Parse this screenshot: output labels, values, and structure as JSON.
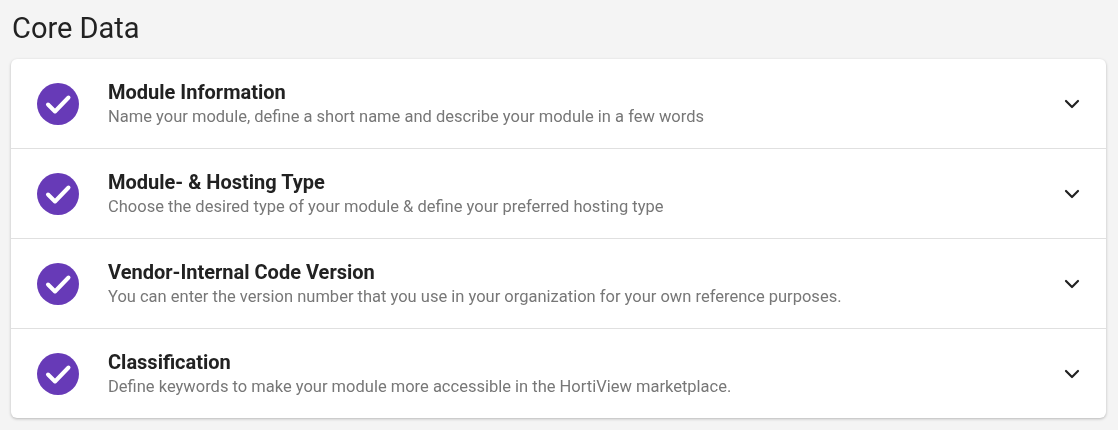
{
  "page": {
    "title": "Core Data"
  },
  "sections": [
    {
      "title": "Module Information",
      "description": "Name your module, define a short name and describe your module in a few words",
      "completed": true,
      "expanded": false
    },
    {
      "title": "Module- & Hosting Type",
      "description": "Choose the desired type of your module & define your preferred hosting type",
      "completed": true,
      "expanded": false
    },
    {
      "title": "Vendor-Internal Code Version",
      "description": "You can enter the version number that you use in your organization for your own reference purposes.",
      "completed": true,
      "expanded": false
    },
    {
      "title": "Classification",
      "description": "Define keywords to make your module more accessible in the HortiView marketplace.",
      "completed": true,
      "expanded": false
    }
  ]
}
